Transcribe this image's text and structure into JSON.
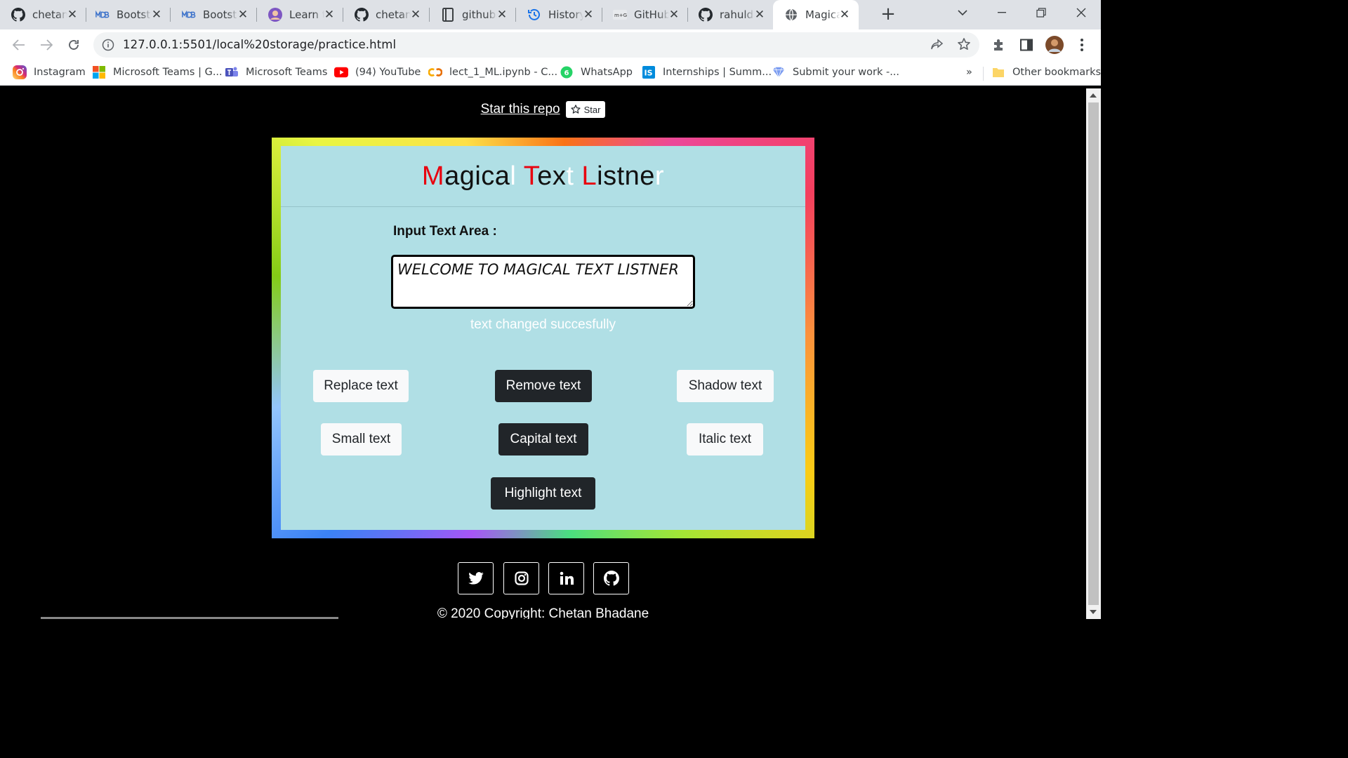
{
  "browser": {
    "tabs": [
      {
        "title": "chetan",
        "icon": "github-icon"
      },
      {
        "title": "Bootst",
        "icon": "mdb-icon"
      },
      {
        "title": "Bootst",
        "icon": "mdb-icon"
      },
      {
        "title": "Learn t",
        "icon": "avatar-icon"
      },
      {
        "title": "chetan",
        "icon": "github-icon"
      },
      {
        "title": "github",
        "icon": "notebook-icon"
      },
      {
        "title": "History",
        "icon": "history-icon"
      },
      {
        "title": "GitHub",
        "icon": "mg-icon"
      },
      {
        "title": "rahuld",
        "icon": "github-icon"
      },
      {
        "title": "Magica",
        "icon": "globe-icon",
        "active": true
      }
    ],
    "url": "127.0.0.1:5501/local%20storage/practice.html",
    "bookmarks": [
      {
        "label": "Instagram",
        "icon": "instagram-icon"
      },
      {
        "label": "Microsoft Teams | G...",
        "icon": "microsoft-icon"
      },
      {
        "label": "Microsoft Teams",
        "icon": "teams-icon"
      },
      {
        "label": "(94) YouTube",
        "icon": "youtube-icon"
      },
      {
        "label": "lect_1_ML.ipynb - C...",
        "icon": "colab-icon"
      },
      {
        "label": "WhatsApp",
        "icon": "whatsapp-icon"
      },
      {
        "label": "Internships | Summ...",
        "icon": "internshala-icon"
      },
      {
        "label": "Submit your work -...",
        "icon": "heart-icon"
      }
    ],
    "overflow_label": "»",
    "other_bookmarks": "Other bookmarks"
  },
  "page": {
    "star_link": "Star this repo",
    "star_button": "Star",
    "title_parts": [
      {
        "text": "M",
        "style": "r"
      },
      {
        "text": "agica",
        "style": "d"
      },
      {
        "text": "l",
        "style": "w"
      },
      {
        "text": " ",
        "style": "d"
      },
      {
        "text": "T",
        "style": "r"
      },
      {
        "text": "ex",
        "style": "d"
      },
      {
        "text": "t",
        "style": "w"
      },
      {
        "text": " ",
        "style": "d"
      },
      {
        "text": "L",
        "style": "r"
      },
      {
        "text": "istne",
        "style": "d"
      },
      {
        "text": "r",
        "style": "w"
      }
    ],
    "input_label": "Input Text Area :",
    "textarea_value": "WELCOME TO MAGICAL TEXT LISTNER",
    "status": "text changed succesfully",
    "buttons": {
      "replace": "Replace text",
      "remove": "Remove text",
      "shadow": "Shadow text",
      "small": "Small text",
      "capital": "Capital text",
      "italic": "Italic text",
      "highlight": "Highlight text"
    },
    "copyright": "© 2020 Copyright: Chetan Bhadane"
  },
  "colors": {
    "card_bg": "#b0dfe5",
    "accent_red": "#e8000e",
    "dark_button": "#212529",
    "light_button": "#f8f9fa"
  }
}
